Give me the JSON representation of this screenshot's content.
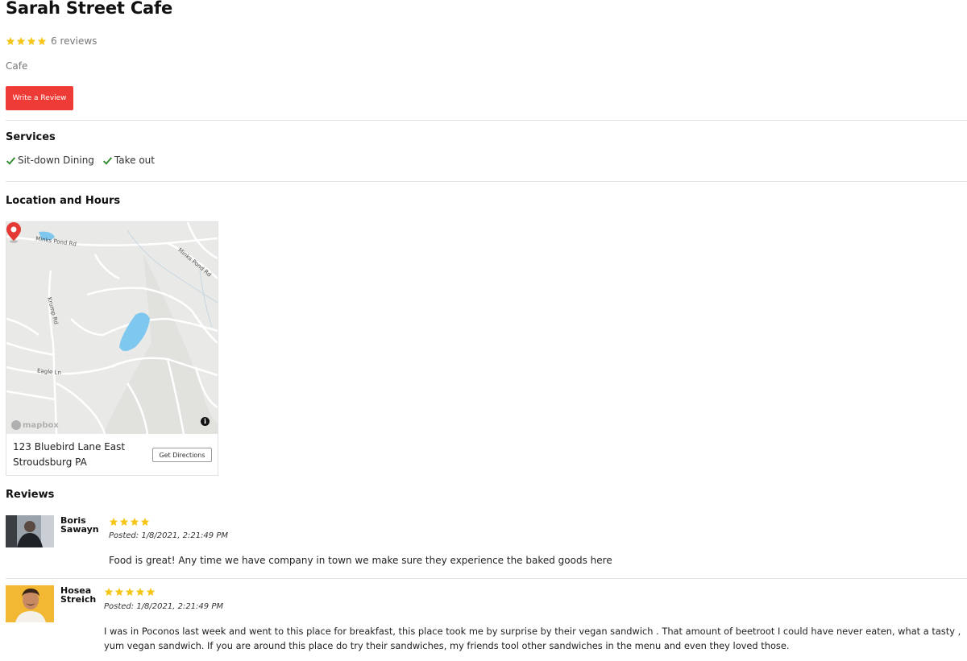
{
  "business": {
    "name": "Sarah Street Cafe",
    "rating": 4,
    "rating_max": 5,
    "review_count": "6 reviews",
    "category": "Cafe",
    "write_review_label": "Write a Review"
  },
  "services": {
    "heading": "Services",
    "items": [
      "Sit-down Dining",
      "Take out"
    ]
  },
  "location": {
    "heading": "Location and Hours",
    "address_line1": "123 Bluebird Lane East",
    "address_line2": "Stroudsburg PA",
    "directions_label": "Get Directions",
    "map": {
      "labels": [
        "Minks Pond Rd",
        "Minks Pond Rd",
        "Krump Rd",
        "Eagle Ln"
      ],
      "attribution": "mapbox",
      "info_glyph": "i"
    }
  },
  "reviews": {
    "heading": "Reviews",
    "items": [
      {
        "name": "Boris Sawayn",
        "rating": 4,
        "posted": "Posted: 1/8/2021, 2:21:49 PM",
        "text": "Food is great! Any time we have company in town we make sure they experience the baked goods here"
      },
      {
        "name": "Hosea Streich",
        "rating": 5,
        "posted": "Posted: 1/8/2021, 2:21:49 PM",
        "text": "I was in Poconos last week and went to this place for breakfast, this place took me by surprise by their vegan sandwich . That amount of beetroot I could have never eaten, what a tasty , yum vegan sandwich. If you are around this place do try their sandwiches, my friends tool other sandwiches in the menu and even they loved those."
      }
    ]
  },
  "colors": {
    "star": "#f5c518",
    "accent_button": "#ef3b36",
    "check": "#2e8b2e",
    "pin": "#e53935",
    "water": "#7ec8ef"
  }
}
